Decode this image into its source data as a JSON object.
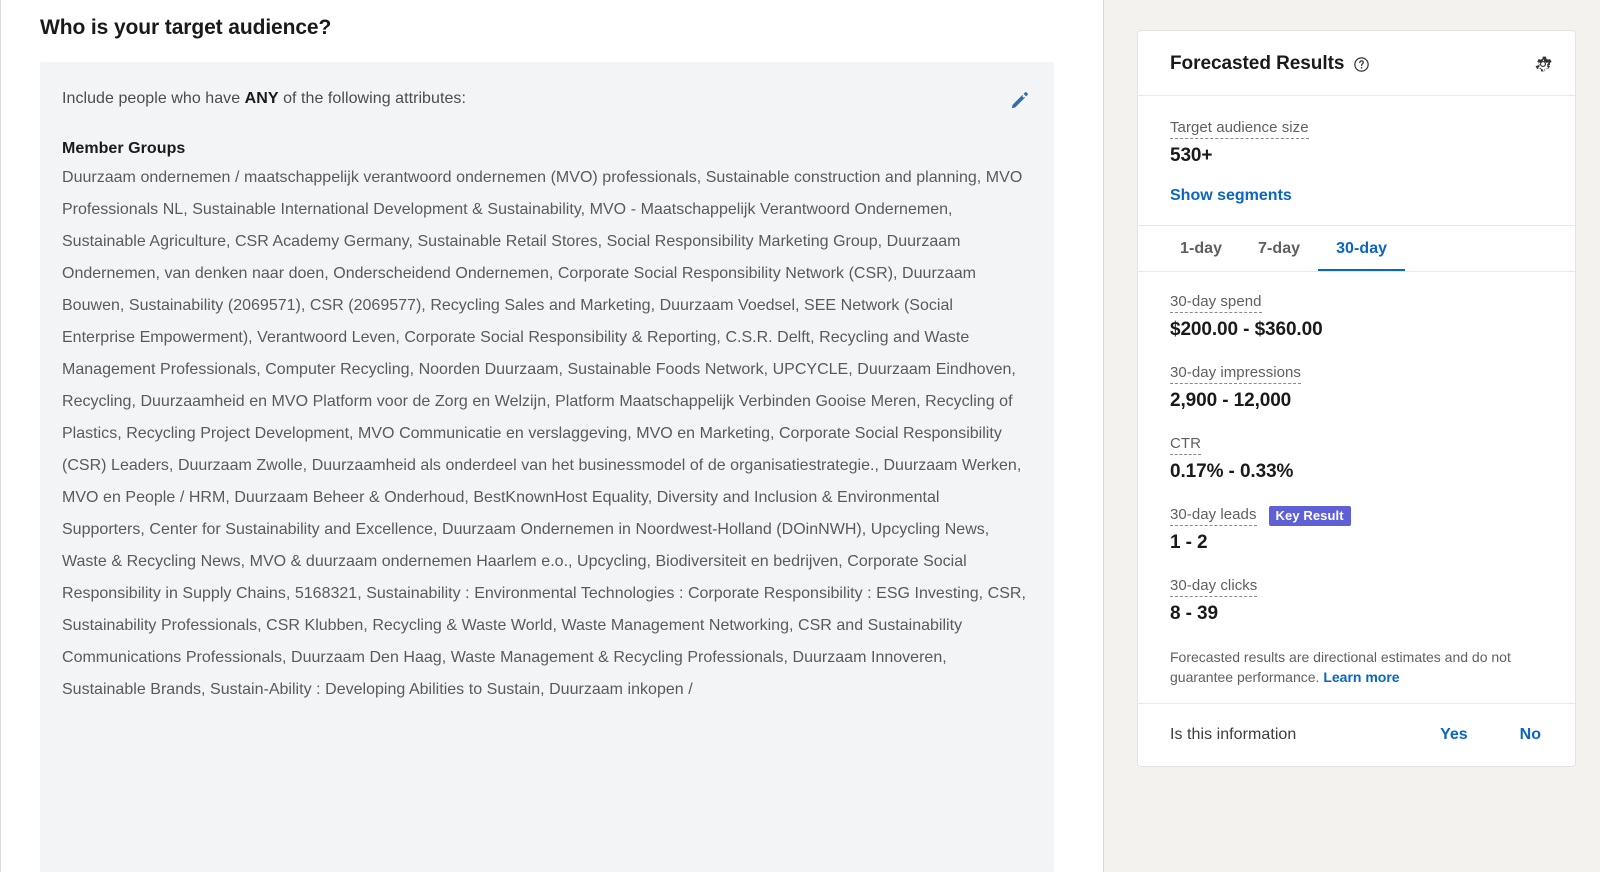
{
  "main": {
    "page_title": "Who is your target audience?",
    "include_prefix": "Include people who have ",
    "include_emphasis": "ANY",
    "include_suffix": " of the following attributes:",
    "edit_icon": "pencil-icon",
    "group_heading": "Member Groups",
    "group_body": "Duurzaam ondernemen / maatschappelijk verantwoord ondernemen (MVO) professionals, Sustainable construction and planning, MVO Professionals NL, Sustainable International Development & Sustainability, MVO - Maatschappelijk Verantwoord Ondernemen, Sustainable Agriculture, CSR Academy Germany, Sustainable Retail Stores, Social Responsibility Marketing Group, Duurzaam Ondernemen, van denken naar doen, Onderscheidend Ondernemen, Corporate Social Responsibility Network (CSR), Duurzaam Bouwen, Sustainability (2069571), CSR (2069577), Recycling Sales and Marketing, Duurzaam Voedsel, SEE Network (Social Enterprise Empowerment), Verantwoord Leven, Corporate Social Responsibility & Reporting, C.S.R. Delft, Recycling and Waste Management Professionals, Computer Recycling, Noorden Duurzaam, Sustainable Foods Network, UPCYCLE, Duurzaam Eindhoven, Recycling, Duurzaamheid en MVO Platform voor de Zorg en Welzijn, Platform Maatschappelijk Verbinden Gooise Meren, Recycling of Plastics, Recycling Project Development, MVO Communicatie en verslaggeving, MVO en Marketing, Corporate Social Responsibility (CSR) Leaders, Duurzaam Zwolle, Duurzaamheid als onderdeel van het businessmodel of de organisatiestrategie., Duurzaam Werken, MVO en People / HRM, Duurzaam Beheer & Onderhoud, BestKnownHost Equality, Diversity and Inclusion & Environmental Supporters, Center for Sustainability and Excellence, Duurzaam Ondernemen in Noordwest-Holland (DOinNWH), Upcycling News, Waste & Recycling News, MVO & duurzaam ondernemen Haarlem e.o., Upcycling, Biodiversiteit en bedrijven, Corporate Social Responsibility in Supply Chains, 5168321, Sustainability : Environmental Technologies : Corporate Responsibility : ESG Investing, CSR, Sustainability Professionals, CSR Klubben, Recycling & Waste World, Waste Management Networking, CSR and Sustainability Communications Professionals, Duurzaam Den Haag, Waste Management & Recycling Professionals, Duurzaam Innoveren, Sustainable Brands, Sustain-Ability : Developing Abilities to Sustain, Duurzaam inkopen /"
  },
  "forecast": {
    "title": "Forecasted Results",
    "help_icon": "question-circle-icon",
    "settings_icon": "gear-icon",
    "audience": {
      "label": "Target audience size",
      "value": "530+",
      "show_segments_label": "Show segments"
    },
    "tabs": [
      {
        "label": "1-day",
        "active": false
      },
      {
        "label": "7-day",
        "active": false
      },
      {
        "label": "30-day",
        "active": true
      }
    ],
    "metrics": [
      {
        "label": "30-day spend",
        "value": "$200.00 - $360.00",
        "badge": ""
      },
      {
        "label": "30-day impressions",
        "value": "2,900 - 12,000",
        "badge": ""
      },
      {
        "label": "CTR",
        "value": "0.17% - 0.33%",
        "badge": ""
      },
      {
        "label": "30-day leads",
        "value": "1 - 2",
        "badge": "Key Result"
      },
      {
        "label": "30-day clicks",
        "value": "8 - 39",
        "badge": ""
      }
    ],
    "disclaimer_text": "Forecasted results are directional estimates and do not guarantee performance. ",
    "disclaimer_link": "Learn more",
    "feedback": {
      "question": "Is this information",
      "yes_label": "Yes",
      "no_label": "No"
    }
  },
  "colors": {
    "link_blue": "#0a66c2",
    "badge_purple": "#5f5fd6",
    "panel_gray": "#f3f4f6",
    "rail_gray": "#f3f2ef"
  }
}
